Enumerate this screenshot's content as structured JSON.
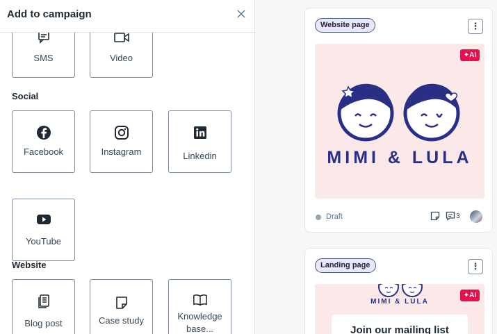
{
  "panel": {
    "title": "Add to campaign"
  },
  "tiles_top": [
    {
      "label": "SMS",
      "icon": "sms-icon"
    },
    {
      "label": "Video",
      "icon": "video-icon"
    }
  ],
  "sections": {
    "social": "Social",
    "website": "Website"
  },
  "social_tiles": [
    {
      "label": "Facebook",
      "icon": "facebook-icon"
    },
    {
      "label": "Instagram",
      "icon": "instagram-icon"
    },
    {
      "label": "Linkedin",
      "icon": "linkedin-icon"
    },
    {
      "label": "YouTube",
      "icon": "youtube-icon"
    }
  ],
  "website_tiles": [
    {
      "label": "Blog post",
      "icon": "blog-post-icon"
    },
    {
      "label": "Case study",
      "icon": "case-study-icon"
    },
    {
      "label": "Knowledge base...",
      "icon": "book-icon"
    }
  ],
  "cards": [
    {
      "type": "Website page",
      "ai_label": "✦AI",
      "brand": "MIMI & LULA",
      "status": "Draft",
      "comment_count": "3"
    },
    {
      "type": "Landing page",
      "ai_label": "✦AI",
      "brand": "MIMI & LULA",
      "headline": "Join our mailing list"
    }
  ],
  "colors": {
    "accent": "#e6104f",
    "badge_bg": "#ebe6ff",
    "thumb_bg": "#fbe9ea",
    "brand_navy": "#2a2f86"
  }
}
